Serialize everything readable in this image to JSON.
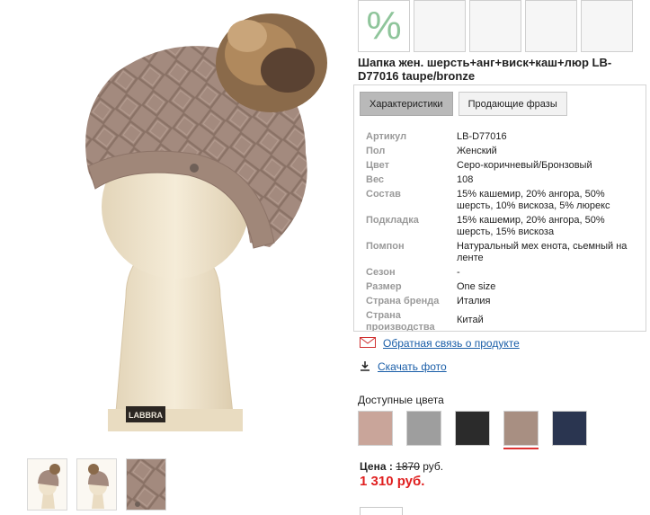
{
  "product": {
    "title": "Шапка жен. шерсть+анг+виск+каш+люр LB-D77016 taupe/bronze",
    "logo_text": "LABBRA"
  },
  "badges": [
    {
      "type": "discount",
      "icon": "percent-icon",
      "text": "%",
      "color": "#8fc59b"
    },
    {
      "type": "empty"
    },
    {
      "type": "empty"
    },
    {
      "type": "empty"
    },
    {
      "type": "empty"
    }
  ],
  "tabs": [
    {
      "label": "Характеристики",
      "active": true
    },
    {
      "label": "Продающие фразы",
      "active": false
    }
  ],
  "specs": [
    {
      "key": "Артикул",
      "value": "LB-D77016"
    },
    {
      "key": "Пол",
      "value": "Женский"
    },
    {
      "key": "Цвет",
      "value": "Серо-коричневый/Бронзовый"
    },
    {
      "key": "Вес",
      "value": "108"
    },
    {
      "key": "Состав",
      "value": "15% кашемир, 20% ангора, 50% шерсть, 10% вискоза, 5% люрекс"
    },
    {
      "key": "Подкладка",
      "value": "15% кашемир, 20% ангора, 50% шерсть, 15% вискоза"
    },
    {
      "key": "Помпон",
      "value": "Натуральный мех енота, сьемный на ленте"
    },
    {
      "key": "Сезон",
      "value": "-"
    },
    {
      "key": "Размер",
      "value": "One size"
    },
    {
      "key": "Страна бренда",
      "value": "Италия"
    },
    {
      "key": "Страна производства",
      "value": "Китай"
    }
  ],
  "links": {
    "feedback": {
      "label": "Обратная связь о продукте",
      "icon": "mail-icon"
    },
    "download": {
      "label": "Скачать фото",
      "icon": "download-icon"
    }
  },
  "colors": {
    "label": "Доступные цвета",
    "swatches": [
      {
        "name": "pink-beige",
        "hex": "#c9a59a",
        "selected": false
      },
      {
        "name": "grey",
        "hex": "#9e9e9e",
        "selected": false
      },
      {
        "name": "black",
        "hex": "#2b2b2b",
        "selected": false
      },
      {
        "name": "taupe",
        "hex": "#a88f82",
        "selected": true
      },
      {
        "name": "navy",
        "hex": "#2a3550",
        "selected": false
      }
    ]
  },
  "price": {
    "label": "Цена :",
    "old_value": "1870",
    "old_currency": "руб.",
    "new_price": "1 310 руб."
  },
  "thumbnails": [
    {
      "name": "thumb-front"
    },
    {
      "name": "thumb-side"
    },
    {
      "name": "thumb-closeup"
    }
  ]
}
